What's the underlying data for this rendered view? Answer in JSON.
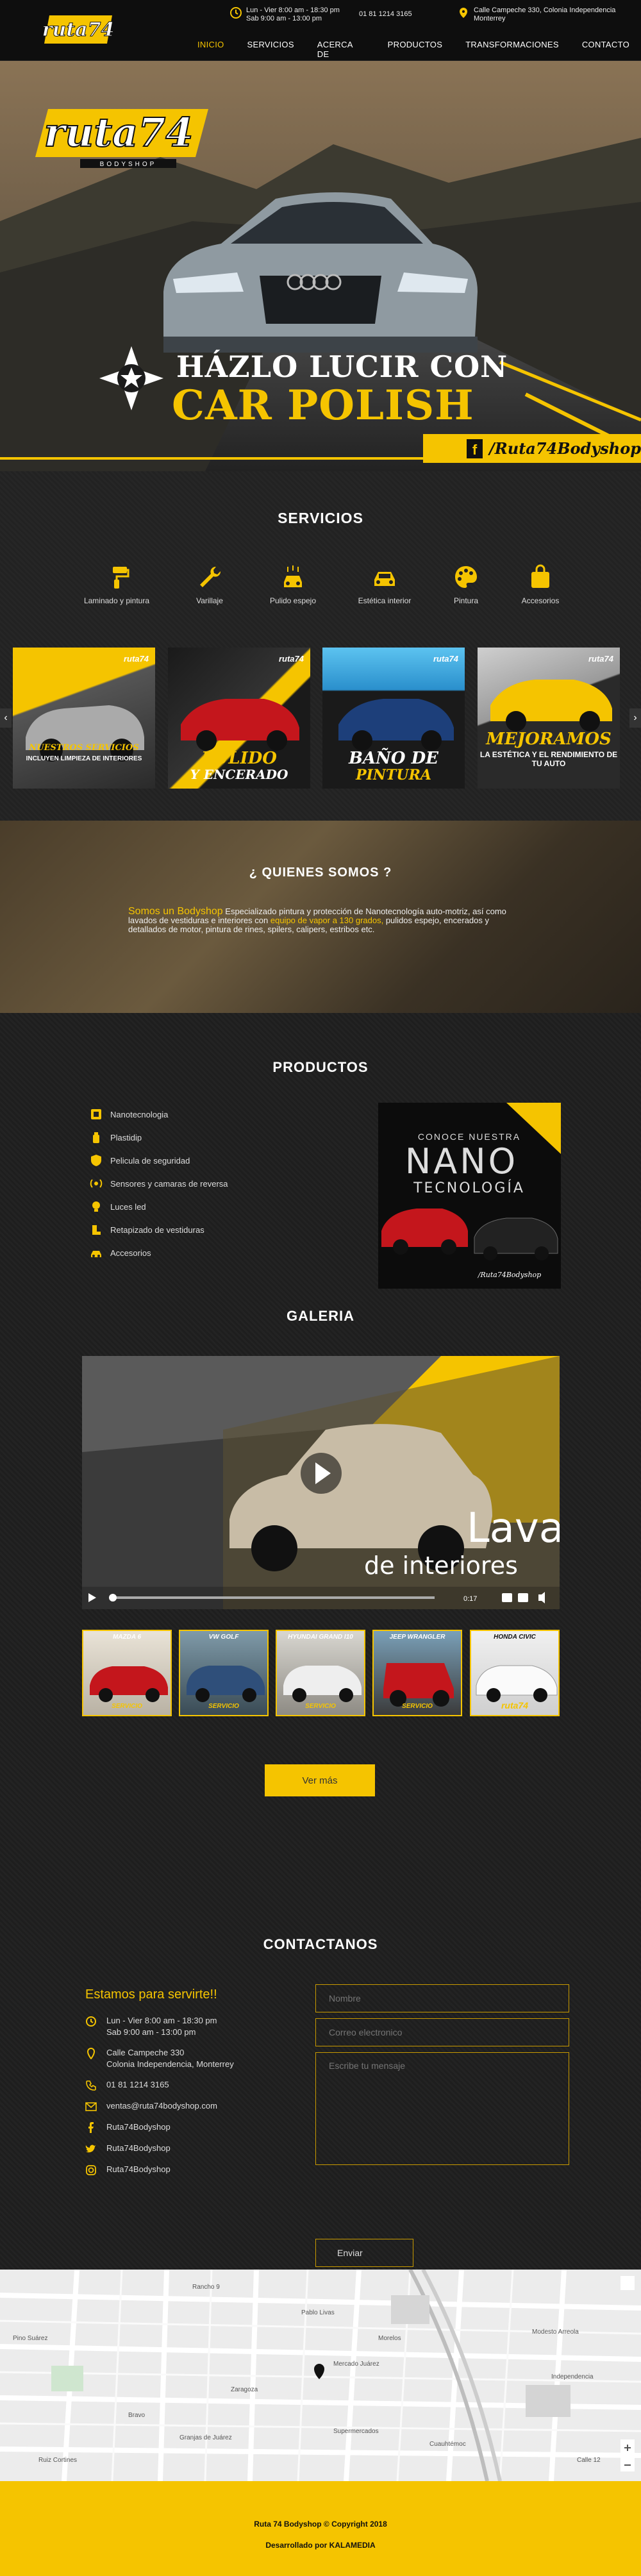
{
  "header": {
    "logo_text": "ruta74",
    "schedule_line1": "Lun - Vier 8:00 am - 18:30 pm",
    "schedule_line2": "Sab 9:00 am - 13:00 pm",
    "phone": "01 81 1214 3165",
    "address_line1": "Calle Campeche 330, Colonia Independencia",
    "address_line2": "Monterrey",
    "nav": [
      "INICIO",
      "SERVICIOS",
      "ACERCA DE NOSOTOS",
      "PRODUCTOS",
      "TRANSFORMACIONES",
      "CONTACTO"
    ],
    "active_nav": "INICIO"
  },
  "hero": {
    "logo_text": "ruta74",
    "logo_sub": "BODYSHOP",
    "title_line1": "HÁZLO LUCIR CON",
    "title_line2": "CAR POLISH",
    "facebook_label": "/Ruta74Bodyshop"
  },
  "servicios": {
    "title": "SERVICIOS",
    "items": [
      {
        "label": "Laminado y pintura",
        "icon": "paint-roller-icon"
      },
      {
        "label": "Varillaje",
        "icon": "wrench-icon"
      },
      {
        "label": "Pulido espejo",
        "icon": "car-wash-icon"
      },
      {
        "label": "Estética interior",
        "icon": "car-front-icon"
      },
      {
        "label": "Pintura",
        "icon": "palette-icon"
      },
      {
        "label": "Accesorios",
        "icon": "bag-icon"
      }
    ],
    "cards": [
      {
        "cap1": "NUESTROS SERVICIOS",
        "cap2": "INCLUYEN LIMPIEZA DE INTERIORES",
        "brand": "ruta74"
      },
      {
        "cap1": "PULIDO",
        "cap2": "Y ENCERADO",
        "brand": "ruta74"
      },
      {
        "cap1": "BAÑO DE",
        "cap2": "PINTURA",
        "brand": "ruta74"
      },
      {
        "cap1": "MEJORAMOS",
        "cap2": "LA ESTÉTICA Y EL RENDIMIENTO DE TU AUTO",
        "brand": "ruta74"
      }
    ],
    "prev": "‹",
    "next": "›"
  },
  "quienes": {
    "title": "¿ QUIENES SOMOS ?",
    "lead": "Somos un Bodyshop",
    "text1": " Especializado pintura y protección de Nanotecnología auto-motriz, así como lavados de vestiduras e interiores con ",
    "highlight": "equipo de vapor a 130 grados,",
    "text2": " pulidos espejo, encerados y detallados de motor, pintura de rines, spilers, calipers, estribos etc."
  },
  "productos": {
    "title": "PRODUCTOS",
    "items": [
      {
        "label": "Nanotecnologia",
        "icon": "nano-icon"
      },
      {
        "label": "Plastidip",
        "icon": "spray-icon"
      },
      {
        "label": "Pelicula de seguridad",
        "icon": "shield-icon"
      },
      {
        "label": "Sensores y camaras de reversa",
        "icon": "sensor-icon"
      },
      {
        "label": "Luces led",
        "icon": "bulb-icon"
      },
      {
        "label": "Retapizado de vestiduras",
        "icon": "seat-icon"
      },
      {
        "label": "Accesorios",
        "icon": "car-icon"
      }
    ],
    "banner_small": "CONOCE NUESTRA",
    "banner_big": "NANO",
    "banner_sub": "TECNOLOGÍA",
    "banner_fb": "/Ruta74Bodyshop"
  },
  "galeria": {
    "title": "GALERIA",
    "video_text1": "Lavado",
    "video_text2": "de interiores",
    "video_time": "0:17",
    "thumbs": [
      {
        "label": "MAZDA 6",
        "tag": "SERVICIO"
      },
      {
        "label": "VW GOLF",
        "tag": "SERVICIO"
      },
      {
        "label": "HYUNDAI GRAND I10",
        "tag": "SERVICIO"
      },
      {
        "label": "JEEP WRANGLER",
        "tag": "SERVICIO"
      },
      {
        "label": "HONDA CIVIC",
        "tag": "ruta74"
      }
    ],
    "ver_mas": "Ver más"
  },
  "contacto": {
    "title": "CONTACTANOS",
    "subtitle": "Estamos para servirte!!",
    "schedule1": "Lun - Vier 8:00 am - 18:30 pm",
    "schedule2": "Sab 9:00 am - 13:00 pm",
    "address1": "Calle Campeche 330",
    "address2": "Colonia Independencia, Monterrey",
    "phone": "01 81 1214 3165",
    "email": "ventas@ruta74bodyshop.com",
    "facebook": "Ruta74Bodyshop",
    "twitter": "Ruta74Bodyshop",
    "instagram": "Ruta74Bodyshop",
    "placeholder_name": "Nombre",
    "placeholder_email": "Correo electronico",
    "placeholder_message": "Escribe tu mensaje",
    "submit": "Enviar"
  },
  "map": {
    "labels": [
      "Rancho 9",
      "Pablo Livas",
      "Morelos",
      "Mercado Juárez",
      "Supermercados",
      "Independencia",
      "Pino Suárez",
      "Zaragoza",
      "Bravo",
      "Cuauhtémoc",
      "Modesto Arreola",
      "Granjas de Juárez",
      "Ruiz Cortines",
      "Calle 12"
    ]
  },
  "footer": {
    "copyright": "Ruta 74 Bodyshop  © Copyright 2018",
    "credits": "Desarrollado por KALAMEDIA"
  },
  "colors": {
    "accent": "#f5c400",
    "background": "#1b1b1b"
  }
}
